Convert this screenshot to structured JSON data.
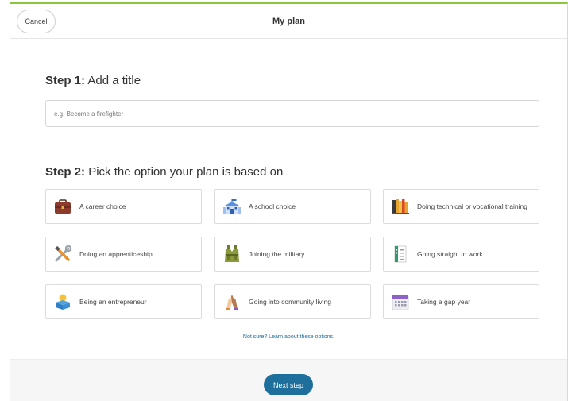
{
  "header": {
    "cancel_label": "Cancel",
    "title": "My plan"
  },
  "step1": {
    "prefix": "Step 1:",
    "text": "Add a title",
    "input_placeholder": "e.g. Become a firefighter",
    "input_value": ""
  },
  "step2": {
    "prefix": "Step 2:",
    "text": "Pick the option your plan is based on",
    "options": [
      {
        "label": "A career choice",
        "icon": "briefcase-icon"
      },
      {
        "label": "A school choice",
        "icon": "school-icon"
      },
      {
        "label": "Doing technical or vocational training",
        "icon": "books-icon"
      },
      {
        "label": "Doing an apprenticeship",
        "icon": "tools-icon"
      },
      {
        "label": "Joining the military",
        "icon": "military-vest-icon"
      },
      {
        "label": "Going straight to work",
        "icon": "checklist-icon"
      },
      {
        "label": "Being an entrepreneur",
        "icon": "lightbulb-box-icon"
      },
      {
        "label": "Going into community living",
        "icon": "high-five-icon"
      },
      {
        "label": "Taking a gap year",
        "icon": "calendar-icon"
      }
    ],
    "help_link": "Not sure? Learn about these options."
  },
  "footer": {
    "next_label": "Next step"
  },
  "colors": {
    "accent_top": "#8cc63f",
    "primary_button": "#1f6f9c"
  }
}
